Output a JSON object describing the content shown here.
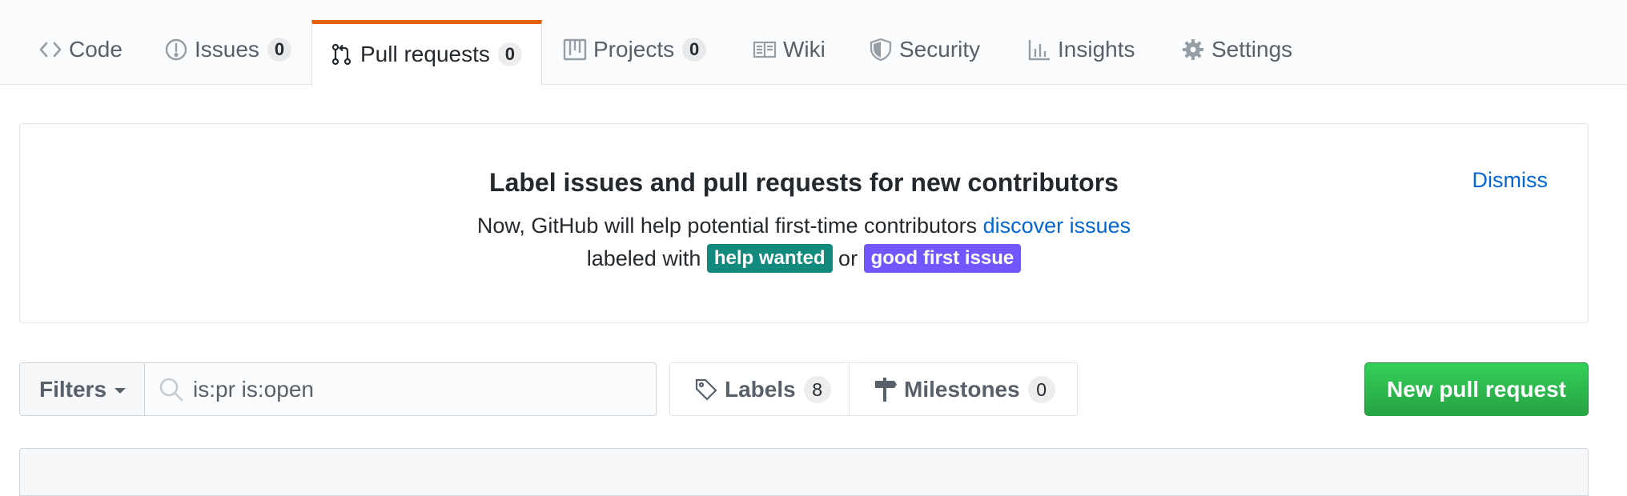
{
  "reponav": {
    "tabs": [
      {
        "label": "Code",
        "icon": "code-icon"
      },
      {
        "label": "Issues",
        "icon": "issue-opened-icon",
        "count": "0"
      },
      {
        "label": "Pull requests",
        "icon": "git-pull-request-icon",
        "count": "0",
        "selected": true
      },
      {
        "label": "Projects",
        "icon": "project-icon",
        "count": "0"
      },
      {
        "label": "Wiki",
        "icon": "book-icon"
      },
      {
        "label": "Security",
        "icon": "shield-icon"
      },
      {
        "label": "Insights",
        "icon": "graph-icon"
      },
      {
        "label": "Settings",
        "icon": "gear-icon"
      }
    ],
    "selected_accent": "#e36209"
  },
  "banner": {
    "title": "Label issues and pull requests for new contributors",
    "line1_text": "Now, GitHub will help potential first-time contributors ",
    "line1_link": "discover issues",
    "line2_prefix": "labeled with ",
    "label1": {
      "text": "help wanted",
      "color": "#128a7d"
    },
    "line2_or": " or ",
    "label2": {
      "text": "good first issue",
      "color": "#7057ff"
    },
    "dismiss": "Dismiss"
  },
  "subnav": {
    "filters_label": "Filters",
    "search_value": "is:pr is:open",
    "labels_label": "Labels",
    "labels_count": "8",
    "milestones_label": "Milestones",
    "milestones_count": "0",
    "new_pr_label": "New pull request",
    "new_pr_color": "#28a745"
  }
}
